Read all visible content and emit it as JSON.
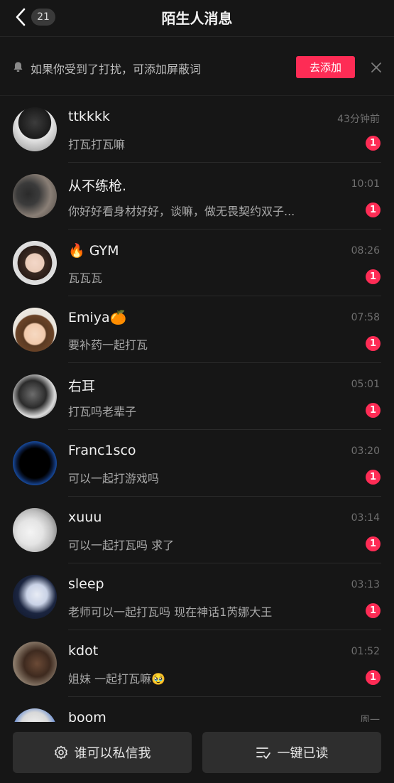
{
  "header": {
    "back_icon": "chevron-left-icon",
    "unread_count": "21",
    "title": "陌生人消息"
  },
  "banner": {
    "icon": "bell-icon",
    "text": "如果你受到了打扰，可添加屏蔽词",
    "action_label": "去添加",
    "close_icon": "close-icon",
    "accent_color": "#fe2c55"
  },
  "messages": [
    {
      "name": "ttkkkk",
      "preview": "打瓦打瓦嘛",
      "time": "43分钟前",
      "badge": "1"
    },
    {
      "name": "从不练枪.",
      "preview": "你好好看身材好好，谈嘛，做无畏契约双子...",
      "time": "10:01",
      "badge": "1"
    },
    {
      "name": "🔥 GYM",
      "preview": "瓦瓦瓦",
      "time": "08:26",
      "badge": "1"
    },
    {
      "name": "Emiya🍊",
      "preview": "要补药一起打瓦",
      "time": "07:58",
      "badge": "1"
    },
    {
      "name": "右耳",
      "preview": "打瓦吗老辈子",
      "time": "05:01",
      "badge": "1"
    },
    {
      "name": "Franc1sco",
      "preview": "可以一起打游戏吗",
      "time": "03:20",
      "badge": "1"
    },
    {
      "name": "xuuu",
      "preview": "可以一起打瓦吗 求了",
      "time": "03:14",
      "badge": "1"
    },
    {
      "name": "sleep",
      "preview": "老师可以一起打瓦吗 现在神话1芮娜大王",
      "time": "03:13",
      "badge": "1"
    },
    {
      "name": "kdot",
      "preview": "姐妹 一起打瓦嘛🥹",
      "time": "01:52",
      "badge": "1"
    },
    {
      "name": "boom",
      "preview": "",
      "time": "周一",
      "badge": ""
    }
  ],
  "bottom": {
    "privacy_label": "谁可以私信我",
    "privacy_icon": "gear-icon",
    "read_all_label": "一键已读",
    "read_all_icon": "mark-read-icon"
  }
}
